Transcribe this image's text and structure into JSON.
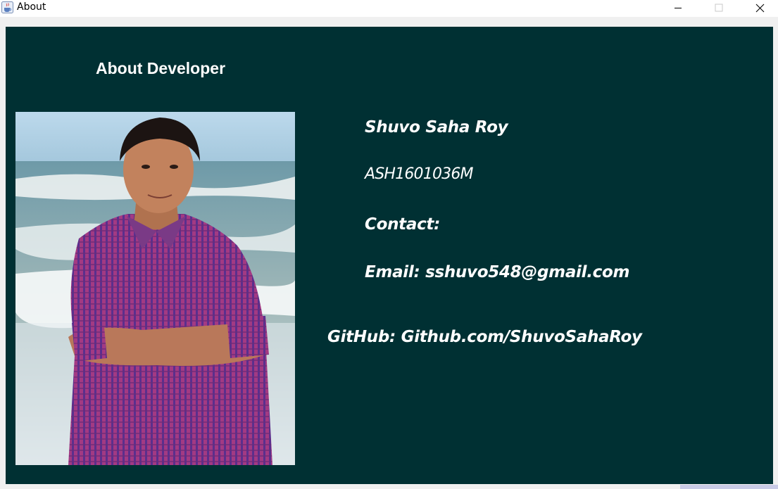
{
  "window": {
    "title": "About",
    "app_icon": "java-cup-icon",
    "controls": {
      "minimize": "minimize-icon",
      "maximize": "maximize-icon",
      "close": "close-icon"
    }
  },
  "content": {
    "heading": "About Developer",
    "name": "Shuvo Saha Roy",
    "student_id": "ASH1601036M",
    "contact_label": "Contact:",
    "email": "Email: sshuvo548@gmail.com",
    "github": "GitHub: Github.com/ShuvoSahaRoy"
  },
  "colors": {
    "panel_background": "#003033",
    "text": "#ffffff",
    "window_background": "#f0f0f0"
  }
}
